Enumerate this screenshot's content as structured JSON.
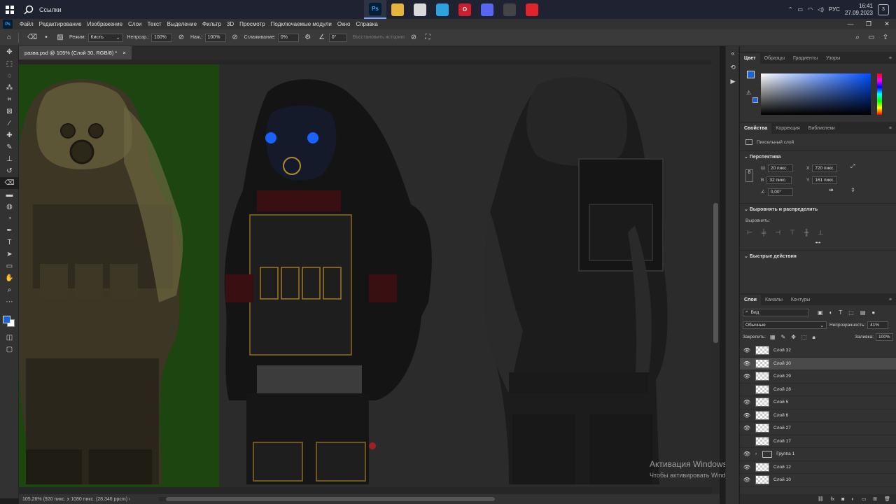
{
  "taskbar": {
    "search_label": "Ссылки",
    "apps": [
      {
        "name": "photoshop",
        "label": "Ps",
        "color": "#001e36",
        "text": "#31a8ff",
        "active": true
      },
      {
        "name": "explorer",
        "label": "",
        "color": "#e7b43a",
        "text": "#000",
        "active": false
      },
      {
        "name": "paint",
        "label": "",
        "color": "#d9d9d9",
        "text": "#000",
        "active": false
      },
      {
        "name": "telegram",
        "label": "",
        "color": "#2aa3e0",
        "text": "#fff",
        "active": false
      },
      {
        "name": "opera",
        "label": "O",
        "color": "#d01e2e",
        "text": "#fff",
        "active": false
      },
      {
        "name": "discord",
        "label": "",
        "color": "#5865f2",
        "text": "#fff",
        "active": false
      },
      {
        "name": "game",
        "label": "",
        "color": "#444",
        "text": "#fff",
        "active": false
      },
      {
        "name": "amd",
        "label": "",
        "color": "#e0242b",
        "text": "#fff",
        "active": false
      }
    ],
    "lang": "РУС",
    "time": "16:41",
    "date": "27.09.2023",
    "notif_count": "3"
  },
  "menu": [
    "Файл",
    "Редактирование",
    "Изображение",
    "Слои",
    "Текст",
    "Выделение",
    "Фильтр",
    "3D",
    "Просмотр",
    "Подключаемые модули",
    "Окно",
    "Справка"
  ],
  "options": {
    "mode_label": "Режим:",
    "mode_value": "Кисть",
    "opacity_label": "Непрозр.:",
    "opacity_value": "100%",
    "pressure_label": "Наж.:",
    "pressure_value": "100%",
    "smoothing_label": "Сглаживание:",
    "smoothing_value": "0%",
    "angle_value": "0°",
    "restore_history": "Восстановить историю"
  },
  "document": {
    "tab_title": "разва.psd @ 105% (Слой 30, RGB/8) *",
    "close": "×",
    "status": "105,26%   (920 пикс. x 1080 пикс. (28,346 ppcm)   ›"
  },
  "watermark": {
    "title": "Активация Windows",
    "subtitle": "Чтобы активировать Windows, перейдите в раздел \"Параметры\"."
  },
  "color_panel": {
    "tabs": [
      "Цвет",
      "Образцы",
      "Градиенты",
      "Узоры"
    ],
    "fg_color": "#1a62d8",
    "picker_hue": "#0050ff"
  },
  "properties_panel": {
    "tabs": [
      "Свойства",
      "Коррекция",
      "Библиотеки"
    ],
    "layer_type": "Пиксельный слой",
    "transform_title": "Перспектива",
    "w_label": "Ш",
    "w_value": "20 пикс.",
    "x_label": "X",
    "x_value": "720 пикс.",
    "h_label": "В",
    "h_value": "32 пикс.",
    "y_label": "Y",
    "y_value": "161 пикс.",
    "angle_value": "0,00°",
    "align_title": "Выровнять и распределить",
    "align_label": "Выровнять:",
    "more": "•••",
    "quick_title": "Быстрые действия"
  },
  "layers_panel": {
    "tabs": [
      "Слои",
      "Каналы",
      "Контуры"
    ],
    "filter_label": "Вид",
    "blend_mode": "Обычные",
    "opacity_label": "Непрозрачность:",
    "opacity_value": "41%",
    "lock_label": "Закрепить:",
    "fill_label": "Заливка:",
    "fill_value": "100%",
    "layers": [
      {
        "name": "Слой 32",
        "visible": true,
        "selected": false,
        "group": false
      },
      {
        "name": "Слой 30",
        "visible": true,
        "selected": true,
        "group": false
      },
      {
        "name": "Слой 29",
        "visible": true,
        "selected": false,
        "group": false
      },
      {
        "name": "Слой 28",
        "visible": false,
        "selected": false,
        "group": false
      },
      {
        "name": "Слой 5",
        "visible": true,
        "selected": false,
        "group": false
      },
      {
        "name": "Слой 6",
        "visible": true,
        "selected": false,
        "group": false
      },
      {
        "name": "Слой 27",
        "visible": true,
        "selected": false,
        "group": false
      },
      {
        "name": "Слой 17",
        "visible": false,
        "selected": false,
        "group": false
      },
      {
        "name": "Группа 1",
        "visible": true,
        "selected": false,
        "group": true
      },
      {
        "name": "Слой 12",
        "visible": true,
        "selected": false,
        "group": false
      },
      {
        "name": "Слой 10",
        "visible": true,
        "selected": false,
        "group": false
      }
    ]
  }
}
